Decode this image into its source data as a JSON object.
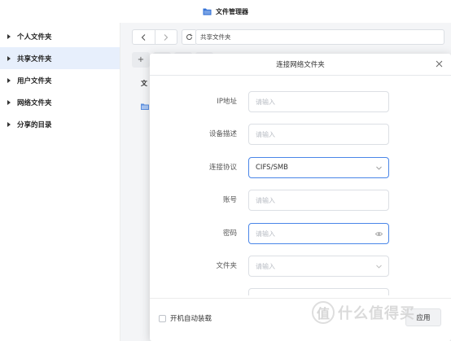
{
  "window": {
    "title": "文件管理器",
    "icon": "folder-icon"
  },
  "sidebar": {
    "items": [
      {
        "label": "个人文件夹",
        "active": false
      },
      {
        "label": "共享文件夹",
        "active": true
      },
      {
        "label": "用户文件夹",
        "active": false
      },
      {
        "label": "网络文件夹",
        "active": false
      },
      {
        "label": "分享的目录",
        "active": false
      }
    ]
  },
  "main": {
    "path": "共享文件夹",
    "toolbar_new": "+",
    "list_header": "文"
  },
  "modal": {
    "title": "连接网络文件夹",
    "fields": {
      "ip": {
        "label": "IP地址",
        "placeholder": "请输入"
      },
      "desc": {
        "label": "设备描述",
        "placeholder": "请输入"
      },
      "protocol": {
        "label": "连接协议",
        "value": "CIFS/SMB"
      },
      "account": {
        "label": "账号",
        "placeholder": "请输入"
      },
      "password": {
        "label": "密码",
        "placeholder": "请输入"
      },
      "folder": {
        "label": "文件夹",
        "placeholder": "请输入"
      }
    },
    "auto_mount_label": "开机自动装载",
    "apply_label": "应用"
  },
  "watermark": {
    "glyph": "值",
    "text": "什么值得买"
  },
  "colors": {
    "accent": "#4a86e8",
    "sidebar_active": "#e7effc"
  }
}
